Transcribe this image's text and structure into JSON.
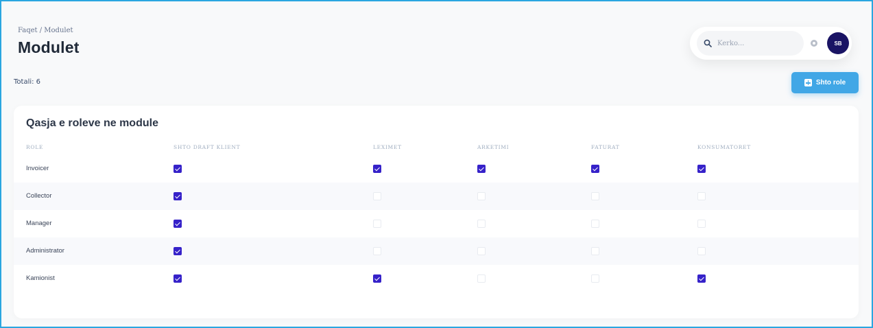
{
  "header": {
    "breadcrumb": "Faqet  /  Modulet",
    "title": "Modulet"
  },
  "navbar": {
    "search_placeholder": "Kerko...",
    "avatar_initials": "SB"
  },
  "toolbar": {
    "total_label": "Totali: 6",
    "add_button_label": "Shto role"
  },
  "card": {
    "title": "Qasja e roleve ne module",
    "columns": [
      "ROLE",
      "SHTO DRAFT KLIENT",
      "LEXIMET",
      "ARKETIMI",
      "FATURAT",
      "KONSUMATORET"
    ],
    "rows": [
      {
        "role": "Invoicer",
        "access": [
          true,
          true,
          true,
          true,
          true
        ]
      },
      {
        "role": "Collector",
        "access": [
          true,
          false,
          false,
          false,
          false
        ]
      },
      {
        "role": "Manager",
        "access": [
          true,
          false,
          false,
          false,
          false
        ]
      },
      {
        "role": "Administrator",
        "access": [
          true,
          false,
          false,
          false,
          false
        ]
      },
      {
        "role": "Kamionist",
        "access": [
          true,
          true,
          false,
          false,
          true
        ]
      }
    ]
  },
  "colors": {
    "accent": "#41a7e6",
    "checkbox_checked": "#3622c9",
    "avatar_bg": "#1a1464",
    "frame_border": "#2aa6e0"
  }
}
